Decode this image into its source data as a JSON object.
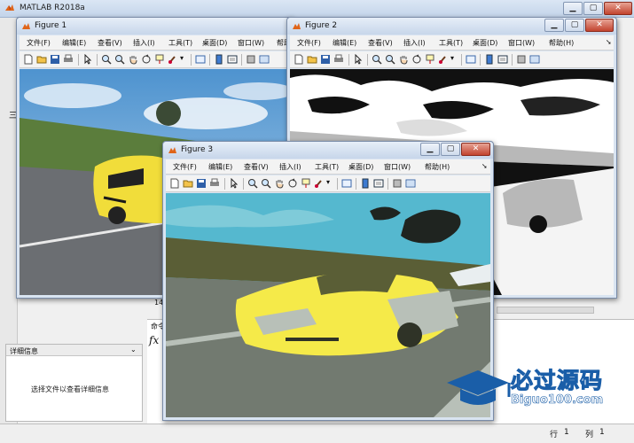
{
  "main_window": {
    "title": "MATLAB R2018a",
    "detail_panel": {
      "title": "详细信息",
      "message": "选择文件以查看详细信息"
    },
    "command_window": {
      "label": "命令",
      "prompt": "fx"
    },
    "side_number": "14",
    "side_symbol": "三",
    "status": {
      "row_label": "行",
      "row_value": "1",
      "col_label": "列",
      "col_value": "1"
    }
  },
  "figures": [
    {
      "id": "figure1",
      "title": "Figure 1",
      "menu": [
        "文件(F)",
        "编辑(E)",
        "查看(V)",
        "插入(I)",
        "工具(T)",
        "桌面(D)",
        "窗口(W)",
        "帮助"
      ],
      "image": {
        "style": "original color photo",
        "description_colors": {
          "sky": "#7ab0d8",
          "car": "#f1dd3a",
          "road": "#6b6e72",
          "grass": "#6f8a4a"
        }
      }
    },
    {
      "id": "figure2",
      "title": "Figure 2",
      "menu": [
        "文件(F)",
        "编辑(E)",
        "查看(V)",
        "插入(I)",
        "工具(T)",
        "桌面(D)",
        "窗口(W)",
        "帮助(H)"
      ],
      "image": {
        "style": "binary black/white",
        "description_colors": {
          "light": "#ffffff",
          "mid": "#b8b8b8",
          "dark": "#111111"
        }
      }
    },
    {
      "id": "figure3",
      "title": "Figure 3",
      "menu": [
        "文件(F)",
        "编辑(E)",
        "查看(V)",
        "插入(I)",
        "工具(T)",
        "桌面(D)",
        "窗口(W)",
        "帮助(H)"
      ],
      "image": {
        "style": "color-quantized",
        "description_colors": {
          "sky": "#55b8cf",
          "car": "#f5ea49",
          "road": "#727a70",
          "grass": "#5a5e36",
          "dark": "#2f3327"
        }
      }
    }
  ],
  "watermark": {
    "main": "必过源码",
    "sub": "Biguo100.com"
  }
}
